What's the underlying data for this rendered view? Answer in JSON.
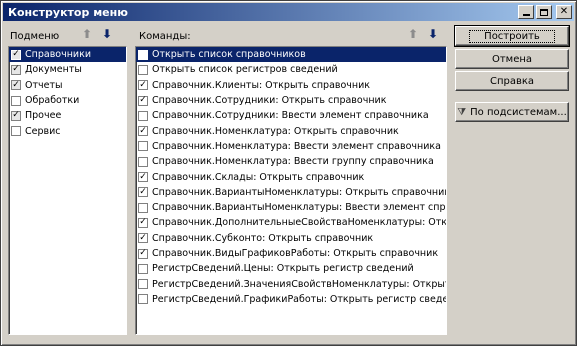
{
  "window": {
    "title": "Конструктор меню"
  },
  "sections_panel": {
    "label": "Подменю",
    "items": [
      {
        "label": "Справочники",
        "checked": true,
        "gray": true,
        "selected": true
      },
      {
        "label": "Документы",
        "checked": true,
        "gray": true,
        "selected": false
      },
      {
        "label": "Отчеты",
        "checked": true,
        "gray": true,
        "selected": false
      },
      {
        "label": "Обработки",
        "checked": false,
        "gray": false,
        "selected": false
      },
      {
        "label": "Прочее",
        "checked": true,
        "gray": true,
        "selected": false
      },
      {
        "label": "Сервис",
        "checked": false,
        "gray": false,
        "selected": false
      }
    ]
  },
  "commands_panel": {
    "label": "Команды:",
    "items": [
      {
        "label": "Открыть список справочников",
        "checked": false,
        "selected": true
      },
      {
        "label": "Открыть список регистров сведений",
        "checked": false,
        "selected": false
      },
      {
        "label": "Справочник.Клиенты: Открыть справочник",
        "checked": true,
        "selected": false
      },
      {
        "label": "Справочник.Сотрудники: Открыть справочник",
        "checked": true,
        "selected": false
      },
      {
        "label": "Справочник.Сотрудники: Ввести элемент справочника",
        "checked": false,
        "selected": false
      },
      {
        "label": "Справочник.Номенклатура: Открыть справочник",
        "checked": true,
        "selected": false
      },
      {
        "label": "Справочник.Номенклатура: Ввести элемент справочника",
        "checked": false,
        "selected": false
      },
      {
        "label": "Справочник.Номенклатура: Ввести группу справочника",
        "checked": false,
        "selected": false
      },
      {
        "label": "Справочник.Склады: Открыть справочник",
        "checked": true,
        "selected": false
      },
      {
        "label": "Справочник.ВариантыНоменклатуры: Открыть справочник",
        "checked": true,
        "selected": false
      },
      {
        "label": "Справочник.ВариантыНоменклатуры: Ввести элемент справо...",
        "checked": false,
        "selected": false
      },
      {
        "label": "Справочник.ДополнительныеСвойстваНоменклатуры: Открыт...",
        "checked": true,
        "selected": false
      },
      {
        "label": "Справочник.Субконто: Открыть справочник",
        "checked": true,
        "selected": false
      },
      {
        "label": "Справочник.ВидыГрафиковРаботы: Открыть справочник",
        "checked": true,
        "selected": false
      },
      {
        "label": "РегистрСведений.Цены: Открыть регистр сведений",
        "checked": false,
        "selected": false
      },
      {
        "label": "РегистрСведений.ЗначенияСвойствНоменклатуры: Открыть р...",
        "checked": false,
        "selected": false
      },
      {
        "label": "РегистрСведений.ГрафикиРаботы: Открыть регистр сведений",
        "checked": false,
        "selected": false
      }
    ]
  },
  "buttons": {
    "build": "Построить",
    "cancel": "Отмена",
    "help": "Справка",
    "by_subsystems": "По подсистемам..."
  },
  "icons": {
    "up": "move-up-arrow",
    "down": "move-down-arrow",
    "filter": "filter-icon"
  }
}
